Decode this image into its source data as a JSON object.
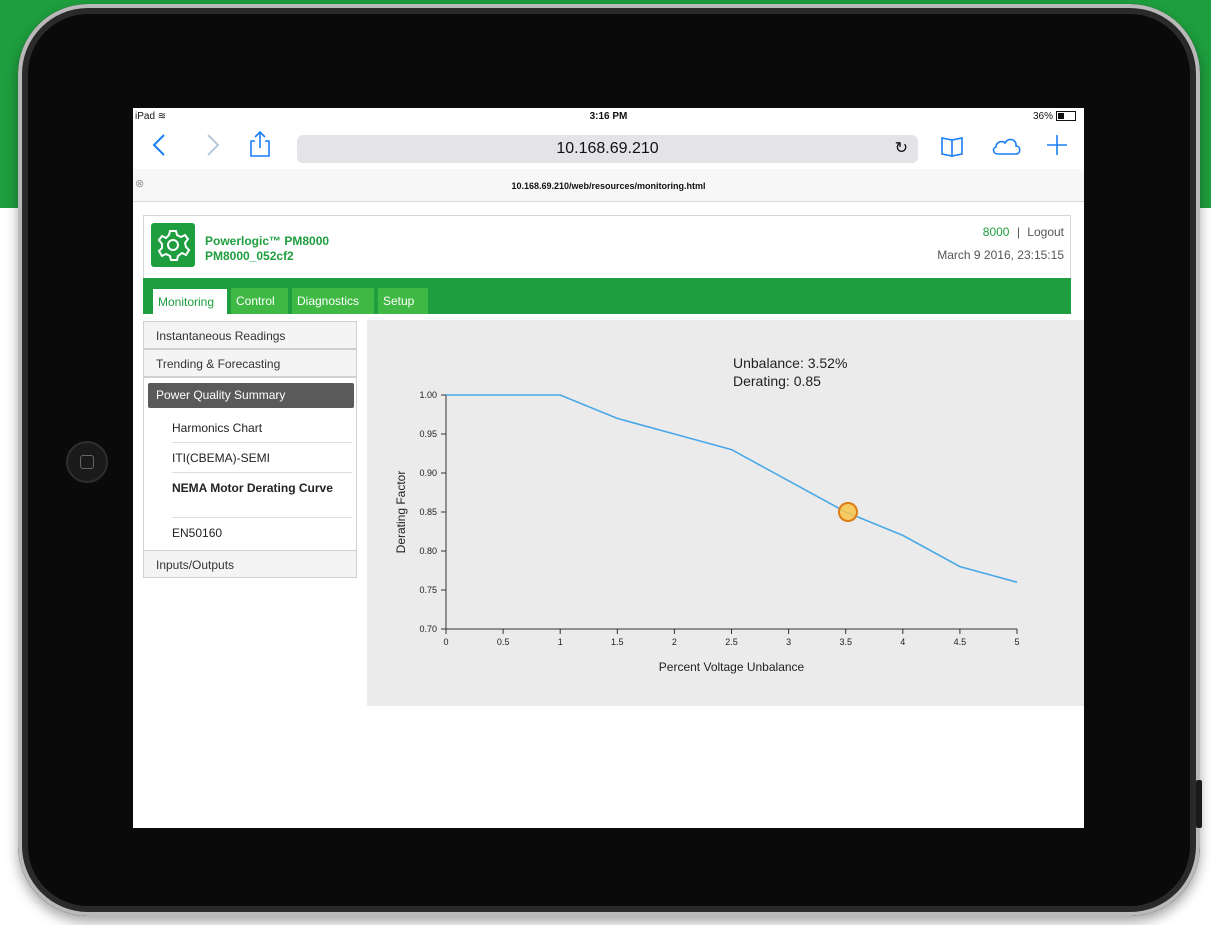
{
  "status_bar": {
    "device": "iPad",
    "time": "3:16 PM",
    "battery": "36%"
  },
  "browser": {
    "address": "10.168.69.210",
    "tab_url": "10.168.69.210/web/resources/monitoring.html",
    "icons": [
      "back-icon",
      "forward-icon",
      "share-icon",
      "reload-icon",
      "bookmarks-icon",
      "cloud-tabs-icon",
      "new-tab-icon"
    ]
  },
  "app": {
    "brand_line1": "Powerlogic™ PM8000",
    "brand_line2": "PM8000_052cf2",
    "user": "8000",
    "separator": "|",
    "logout": "Logout",
    "datetime": "March 9 2016, 23:15:15",
    "nav_tabs": [
      "Monitoring",
      "Control",
      "Diagnostics",
      "Setup"
    ],
    "active_tab": "Monitoring",
    "colors": {
      "brand_green": "#1e9e3e",
      "tab_green": "#3fb844",
      "curve": "#4aa8e8",
      "marker": "#f5a623"
    }
  },
  "sidebar": {
    "items": [
      "Instantaneous Readings",
      "Trending & Forecasting"
    ],
    "active_section": "Power Quality Summary",
    "sub_items": [
      "Harmonics Chart",
      "ITI(CBEMA)-SEMI",
      "NEMA Motor Derating Curve",
      "EN50160"
    ],
    "selected_sub": "NEMA Motor Derating Curve",
    "bottom_item": "Inputs/Outputs"
  },
  "annotation": {
    "unbalance": "Unbalance: 3.52%",
    "derating": "Derating: 0.85"
  },
  "chart_data": {
    "type": "line",
    "xlabel": "Percent Voltage Unbalance",
    "ylabel": "Derating Factor",
    "xlim": [
      0,
      5
    ],
    "ylim": [
      0.7,
      1.0
    ],
    "x_ticks": [
      "0",
      "0.5",
      "1",
      "1.5",
      "2",
      "2.5",
      "3",
      "3.5",
      "4",
      "4.5",
      "5"
    ],
    "y_ticks": [
      "0.70",
      "0.75",
      "0.80",
      "0.85",
      "0.90",
      "0.95",
      "1.00"
    ],
    "series": [
      {
        "x": [
          0,
          0.2,
          1.0,
          1.5,
          2.0,
          2.5,
          3.0,
          3.5,
          4.0,
          4.5,
          5.0
        ],
        "y": [
          1.0,
          1.0,
          1.0,
          0.97,
          0.95,
          0.93,
          0.89,
          0.85,
          0.82,
          0.78,
          0.76
        ]
      }
    ],
    "marker": {
      "x": 3.52,
      "y": 0.85
    },
    "grid": false
  }
}
